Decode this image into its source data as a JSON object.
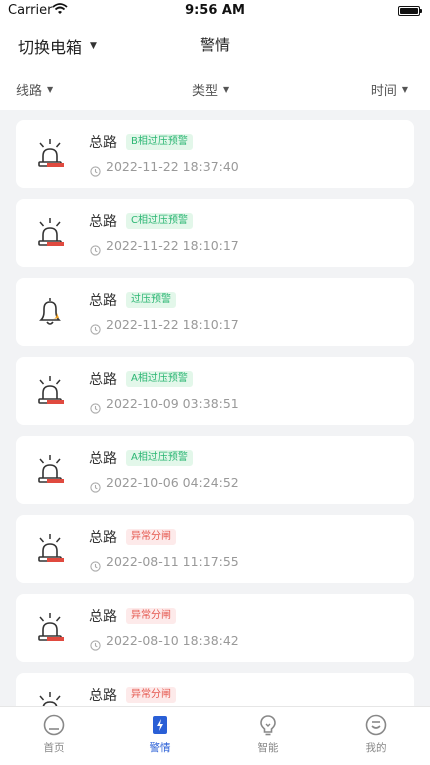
{
  "status_bar": {
    "carrier": "Carrier",
    "time": "9:56 AM"
  },
  "nav": {
    "switch_label": "切换电箱",
    "title": "警情"
  },
  "filters": [
    {
      "label": "线路"
    },
    {
      "label": "类型"
    },
    {
      "label": "时间"
    }
  ],
  "alerts": [
    {
      "name": "总路",
      "tag": "B相过压预警",
      "tag_color": "green",
      "icon": "siren-icon",
      "datetime": "2022-11-22 18:37:40"
    },
    {
      "name": "总路",
      "tag": "C相过压预警",
      "tag_color": "green",
      "icon": "siren-icon",
      "datetime": "2022-11-22 18:10:17"
    },
    {
      "name": "总路",
      "tag": "过压预警",
      "tag_color": "green",
      "icon": "bell-icon",
      "datetime": "2022-11-22 18:10:17"
    },
    {
      "name": "总路",
      "tag": "A相过压预警",
      "tag_color": "green",
      "icon": "siren-icon",
      "datetime": "2022-10-09 03:38:51"
    },
    {
      "name": "总路",
      "tag": "A相过压预警",
      "tag_color": "green",
      "icon": "siren-icon",
      "datetime": "2022-10-06 04:24:52"
    },
    {
      "name": "总路",
      "tag": "异常分闸",
      "tag_color": "red",
      "icon": "siren-icon",
      "datetime": "2022-08-11 11:17:55"
    },
    {
      "name": "总路",
      "tag": "异常分闸",
      "tag_color": "red",
      "icon": "siren-icon",
      "datetime": "2022-08-10 18:38:42"
    },
    {
      "name": "总路",
      "tag": "异常分闸",
      "tag_color": "red",
      "icon": "siren-icon",
      "datetime": ""
    }
  ],
  "tabs": [
    {
      "label": "首页",
      "icon": "home-icon"
    },
    {
      "label": "警情",
      "icon": "alert-icon"
    },
    {
      "label": "智能",
      "icon": "bulb-icon"
    },
    {
      "label": "我的",
      "icon": "profile-icon"
    }
  ],
  "colors": {
    "accent": "#2a5fd6",
    "green_tag": "#2bb673",
    "red_tag": "#e5584f",
    "siren_red": "#e04a3f",
    "bell_orange": "#f0a020"
  }
}
